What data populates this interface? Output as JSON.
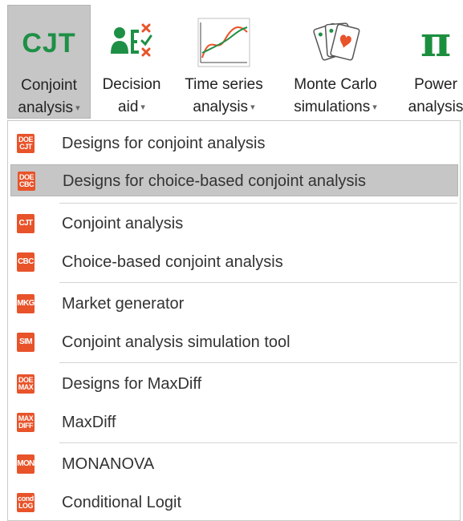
{
  "ribbon": {
    "buttons": [
      {
        "id": "cjt",
        "line1": "Conjoint",
        "line2": "analysis",
        "icon": "cjt-logo-icon",
        "logo_text": "CJT",
        "active": true
      },
      {
        "id": "decision",
        "line1": "Decision",
        "line2": "aid",
        "icon": "decision-aid-icon"
      },
      {
        "id": "ts",
        "line1": "Time series",
        "line2": "analysis",
        "icon": "time-series-chart-icon"
      },
      {
        "id": "mc",
        "line1": "Monte Carlo",
        "line2": "simulations",
        "icon": "playing-cards-icon"
      },
      {
        "id": "power",
        "line1": "Power",
        "line2": "analysis",
        "icon": "pi-icon",
        "logo_text": "π"
      }
    ],
    "caret": "▾"
  },
  "menu": {
    "groups": [
      [
        {
          "label": "Designs for conjoint analysis",
          "badge": [
            "DOE",
            "CJT"
          ],
          "icon": "doe-cjt-icon"
        },
        {
          "label": "Designs for choice-based conjoint analysis",
          "badge": [
            "DOE",
            "CBC"
          ],
          "icon": "doe-cbc-icon",
          "hover": true
        }
      ],
      [
        {
          "label": "Conjoint analysis",
          "badge": [
            "CJT"
          ],
          "icon": "cjt-icon"
        },
        {
          "label": "Choice-based conjoint analysis",
          "badge": [
            "CBC"
          ],
          "icon": "cbc-icon"
        }
      ],
      [
        {
          "label": "Market generator",
          "badge": [
            "MKG"
          ],
          "icon": "mkg-icon"
        },
        {
          "label": "Conjoint analysis simulation tool",
          "badge": [
            "SIM"
          ],
          "icon": "sim-icon"
        }
      ],
      [
        {
          "label": "Designs for MaxDiff",
          "badge": [
            "DOE",
            "MAX"
          ],
          "icon": "doe-max-icon"
        },
        {
          "label": "MaxDiff",
          "badge": [
            "MAX",
            "DIFF"
          ],
          "icon": "maxdiff-icon"
        }
      ],
      [
        {
          "label": "MONANOVA",
          "badge": [
            "MON"
          ],
          "icon": "mon-icon"
        },
        {
          "label": "Conditional Logit",
          "badge": [
            "cond",
            "LOG"
          ],
          "icon": "cond-log-icon"
        }
      ]
    ]
  },
  "colors": {
    "brand_green": "#1e9046",
    "badge_orange": "#e8532a",
    "active_gray": "#c6c6c6"
  }
}
